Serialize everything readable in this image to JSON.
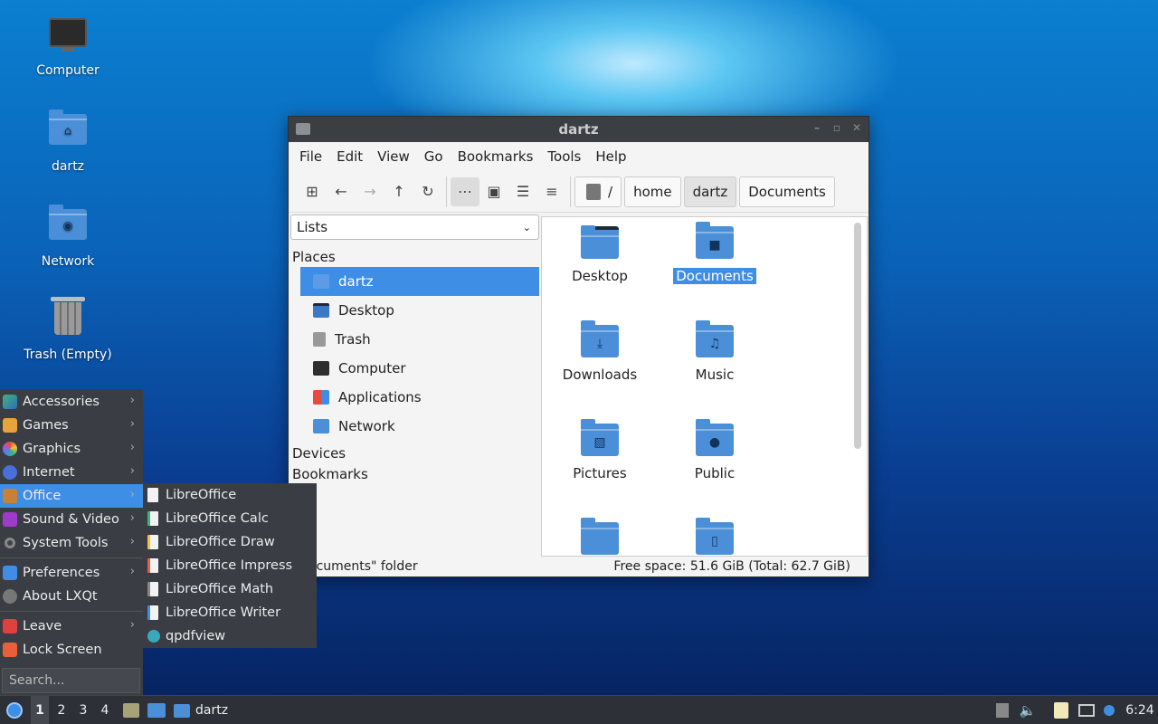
{
  "desktop": {
    "icons": [
      {
        "label": "Computer",
        "icon": "computer-icon"
      },
      {
        "label": "dartz",
        "icon": "home-folder-icon"
      },
      {
        "label": "Network",
        "icon": "network-folder-icon"
      },
      {
        "label": "Trash (Empty)",
        "icon": "trash-icon"
      }
    ]
  },
  "window": {
    "title": "dartz",
    "menu": [
      "File",
      "Edit",
      "View",
      "Go",
      "Bookmarks",
      "Tools",
      "Help"
    ],
    "breadcrumb": [
      "/",
      "home",
      "dartz",
      "Documents"
    ],
    "side": {
      "selector": "Lists",
      "places_header": "Places",
      "places": [
        {
          "label": "dartz",
          "icon": "home-icon",
          "selected": true
        },
        {
          "label": "Desktop",
          "icon": "desktop-icon"
        },
        {
          "label": "Trash",
          "icon": "trash-icon"
        },
        {
          "label": "Computer",
          "icon": "computer-icon"
        },
        {
          "label": "Applications",
          "icon": "applications-icon"
        },
        {
          "label": "Network",
          "icon": "network-icon"
        }
      ],
      "devices_header": "Devices",
      "bookmarks_header": "Bookmarks"
    },
    "files": [
      {
        "name": "Desktop",
        "icon": "desktop-folder-icon"
      },
      {
        "name": "Documents",
        "icon": "documents-folder-icon",
        "selected": true
      },
      {
        "name": "Downloads",
        "icon": "downloads-folder-icon"
      },
      {
        "name": "Music",
        "icon": "music-folder-icon"
      },
      {
        "name": "Pictures",
        "icon": "pictures-folder-icon"
      },
      {
        "name": "Public",
        "icon": "public-folder-icon"
      },
      {
        "name": "",
        "icon": "folder-icon"
      },
      {
        "name": "",
        "icon": "templates-folder-icon"
      }
    ],
    "status_left": "ocuments\" folder",
    "status_right": "Free space: 51.6 GiB (Total: 62.7 GiB)"
  },
  "start_menu": {
    "items": [
      {
        "label": "Accessories",
        "icon": "accessories-icon",
        "submenu": true
      },
      {
        "label": "Games",
        "icon": "games-icon",
        "submenu": true
      },
      {
        "label": "Graphics",
        "icon": "graphics-icon",
        "submenu": true
      },
      {
        "label": "Internet",
        "icon": "internet-icon",
        "submenu": true
      },
      {
        "label": "Office",
        "icon": "office-icon",
        "submenu": true,
        "selected": true
      },
      {
        "label": "Sound & Video",
        "icon": "sound-video-icon",
        "submenu": true
      },
      {
        "label": "System Tools",
        "icon": "system-tools-icon",
        "submenu": true
      }
    ],
    "items2": [
      {
        "label": "Preferences",
        "icon": "preferences-icon",
        "submenu": true
      },
      {
        "label": "About LXQt",
        "icon": "info-icon",
        "submenu": false
      }
    ],
    "items3": [
      {
        "label": "Leave",
        "icon": "power-icon",
        "submenu": true
      },
      {
        "label": "Lock Screen",
        "icon": "lock-icon",
        "submenu": false
      }
    ],
    "search_placeholder": "Search...",
    "office_submenu": [
      "LibreOffice",
      "LibreOffice Calc",
      "LibreOffice Draw",
      "LibreOffice Impress",
      "LibreOffice Math",
      "LibreOffice Writer",
      "qpdfview"
    ]
  },
  "taskbar": {
    "workspaces": [
      "1",
      "2",
      "3",
      "4"
    ],
    "task_label": "dartz",
    "clock": "6:24"
  },
  "colors": {
    "accent": "#3f8ee6",
    "folder": "#4a8fd8",
    "panel": "#3a3d43",
    "titlebar": "#3b3e43"
  }
}
